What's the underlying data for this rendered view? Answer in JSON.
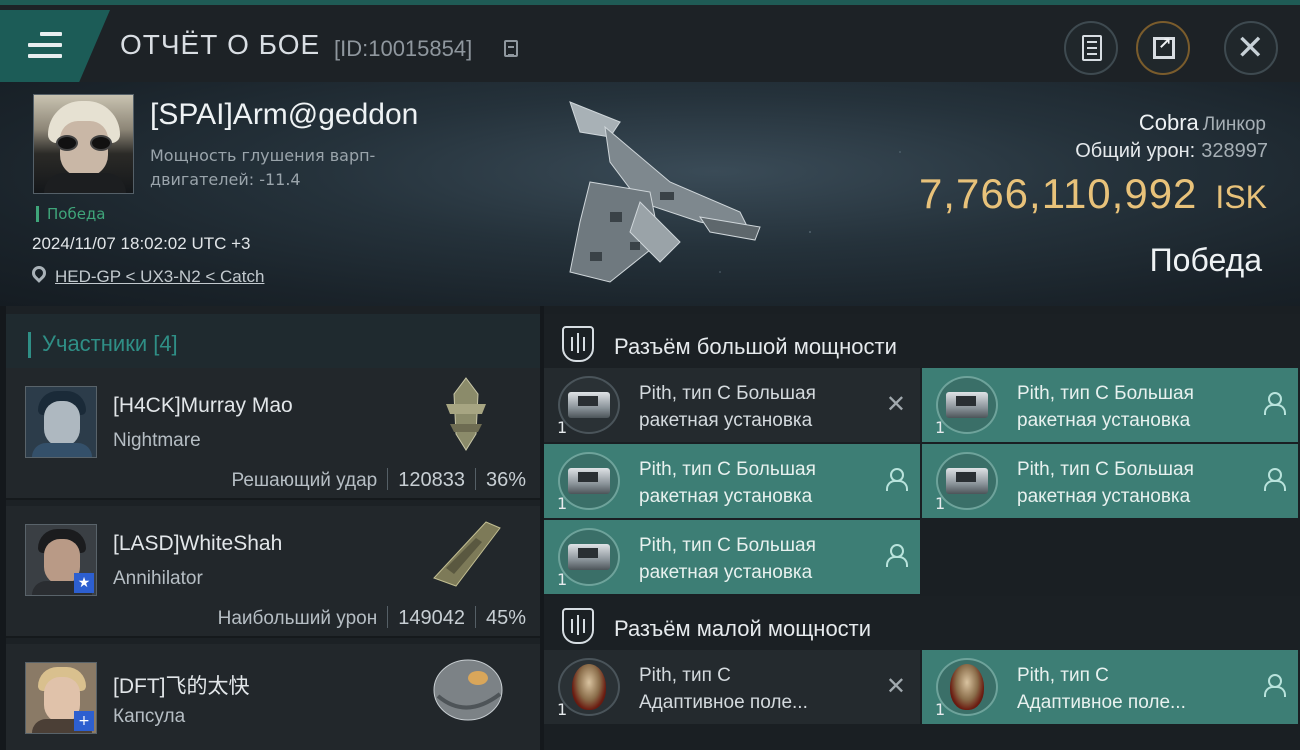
{
  "header": {
    "title": "ОТЧЁТ О БОЕ",
    "report_id": "[ID:10015854]",
    "icons": [
      "menu-icon",
      "copy-icon",
      "notes-icon",
      "share-icon",
      "close-icon"
    ]
  },
  "victim": {
    "name": "[SPAI]Arm@geddon",
    "note": "Мощность глушения варп-двигателей: -11.4",
    "status_tag": "Победа",
    "datetime": "2024/11/07 18:02:02 UTC +3",
    "location": "HED-GP < UX3-N2 < Catch",
    "ship_name": "Cobra",
    "ship_class": "Линкор",
    "damage_label": "Общий урон:",
    "damage_value": "328997",
    "isk_value": "7,766,110,992",
    "isk_unit": "ISK",
    "result": "Победа"
  },
  "participants": {
    "title": "Участники [4]",
    "items": [
      {
        "name": "[H4CK]Murray Mao",
        "ship": "Nightmare",
        "label": "Решающий удар",
        "damage": "120833",
        "percent": "36%"
      },
      {
        "name": "[LASD]WhiteShah",
        "ship": "Annihilator",
        "label": "Наибольший урон",
        "damage": "149042",
        "percent": "45%",
        "badge": "★"
      },
      {
        "name": "[DFT]飞的太快",
        "ship": "Капсула",
        "badge": "+"
      }
    ]
  },
  "fittings": {
    "high_slots": {
      "title": "Разъём большой мощности",
      "modules": [
        {
          "name_line1": "Pith, тип C Большая",
          "name_line2": "ракетная установка",
          "qty": "1",
          "state": "destroyed",
          "flag_glyph": "✕"
        },
        {
          "name_line1": "Pith, тип C Большая",
          "name_line2": "ракетная установка",
          "qty": "1",
          "state": "dropped"
        },
        {
          "name_line1": "Pith, тип C Большая",
          "name_line2": "ракетная установка",
          "qty": "1",
          "state": "dropped"
        },
        {
          "name_line1": "Pith, тип C Большая",
          "name_line2": "ракетная установка",
          "qty": "1",
          "state": "dropped"
        },
        {
          "name_line1": "Pith, тип C Большая",
          "name_line2": "ракетная установка",
          "qty": "1",
          "state": "dropped"
        }
      ]
    },
    "low_slots": {
      "title": "Разъём малой мощности",
      "modules": [
        {
          "name_line1": "Pith, тип C",
          "name_line2": "Адаптивное поле...",
          "qty": "1",
          "state": "destroyed",
          "flag_glyph": "✕"
        },
        {
          "name_line1": "Pith, тип C",
          "name_line2": "Адаптивное поле...",
          "qty": "1",
          "state": "dropped"
        }
      ]
    }
  },
  "colors": {
    "accent_teal": "#2f8f86",
    "dropped_bg": "#3d7e75",
    "isk_gold": "#e8c27a",
    "victory_green": "#3fa57a"
  }
}
